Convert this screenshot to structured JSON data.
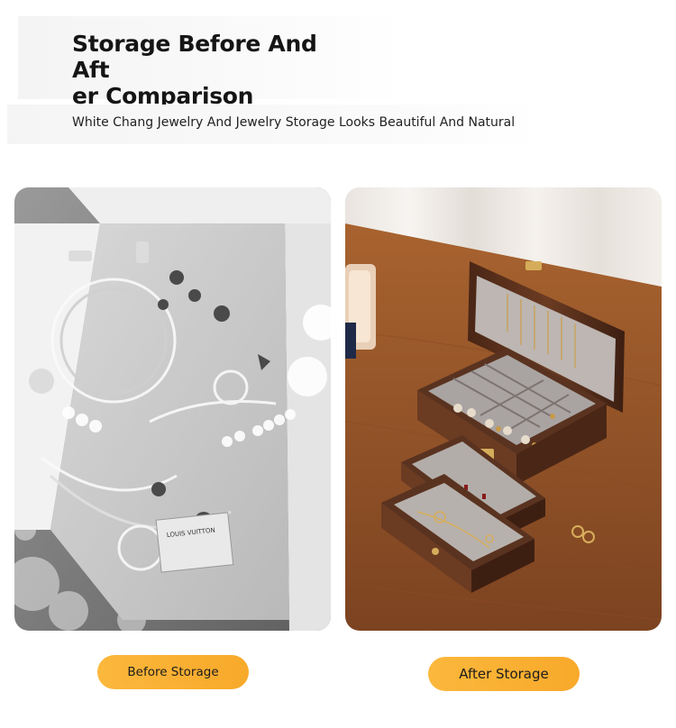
{
  "header": {
    "title_line1": "Storage Before And Aft",
    "title_line2": "er Comparison",
    "subtitle": "White Chang Jewelry And Jewelry Storage Looks Beautiful And Natural"
  },
  "comparison": {
    "before_label": "Before Storage",
    "after_label": "After Storage",
    "before_box_text": "LOUIS VUITTON"
  },
  "colors": {
    "accent_pill": "#f9ac2e",
    "wood": "#5a3320",
    "table": "#9b5a2e"
  }
}
